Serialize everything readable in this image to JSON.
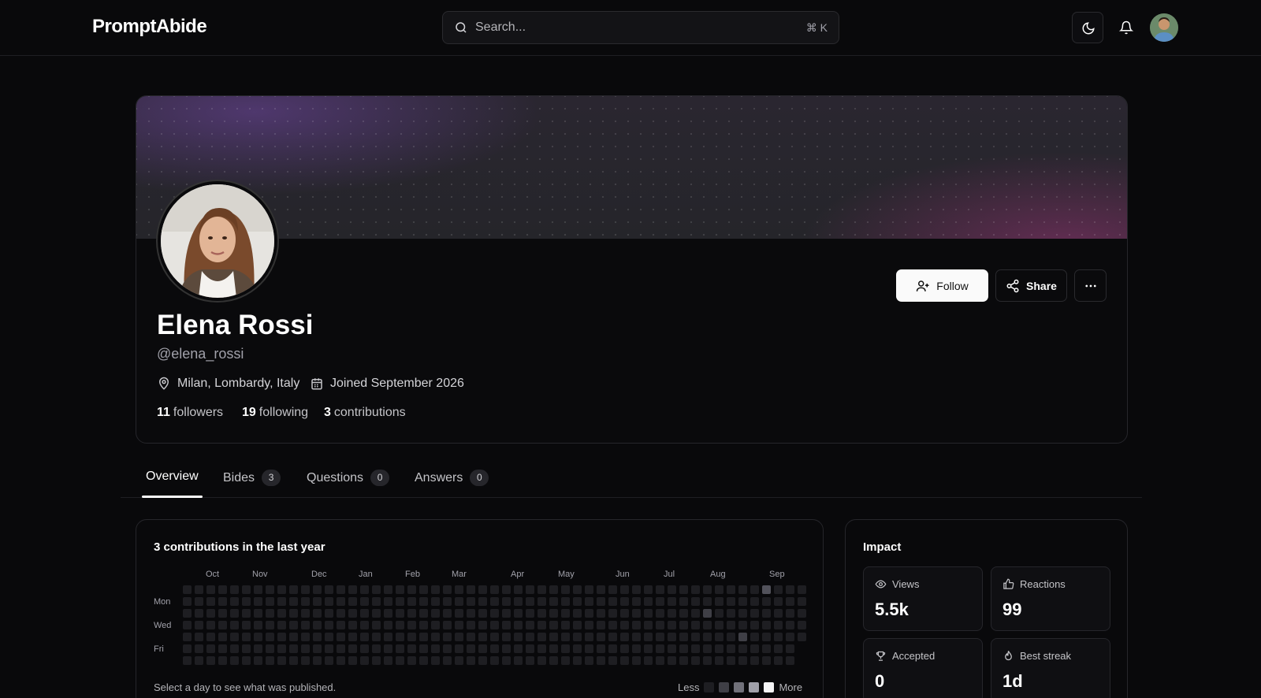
{
  "header": {
    "logo": "PromptAbide",
    "search_placeholder": "Search...",
    "shortcut": "⌘ K"
  },
  "profile": {
    "name": "Elena Rossi",
    "handle": "@elena_rossi",
    "location": "Milan, Lombardy, Italy",
    "joined": "Joined September 2026",
    "stats": [
      {
        "value": "11",
        "label": "followers"
      },
      {
        "value": "19",
        "label": "following"
      },
      {
        "value": "3",
        "label": "contributions"
      }
    ],
    "follow_label": "Follow",
    "share_label": "Share"
  },
  "tabs": [
    {
      "label": "Overview",
      "count": null,
      "active": true
    },
    {
      "label": "Bides",
      "count": "3"
    },
    {
      "label": "Questions",
      "count": "0"
    },
    {
      "label": "Answers",
      "count": "0"
    }
  ],
  "contributions": {
    "title": "3 contributions in the last year",
    "months": [
      "Oct",
      "Nov",
      "Dec",
      "Jan",
      "Feb",
      "Mar",
      "Apr",
      "May",
      "Jun",
      "Jul",
      "Aug",
      "Sep"
    ],
    "day_labels": [
      "Mon",
      "Wed",
      "Fri"
    ],
    "hint": "Select a day to see what was published.",
    "legend_less": "Less",
    "legend_more": "More",
    "colors": {
      "empty": "#1e1e22",
      "level1": "#3f3f46",
      "level2": "#52525b"
    }
  },
  "impact": {
    "title": "Impact",
    "tiles": [
      {
        "label": "Views",
        "value": "5.5k",
        "icon": "eye-icon"
      },
      {
        "label": "Reactions",
        "value": "99",
        "icon": "thumbs-up-icon"
      },
      {
        "label": "Accepted",
        "value": "0",
        "icon": "trophy-icon"
      },
      {
        "label": "Best streak",
        "value": "1d",
        "icon": "flame-icon"
      }
    ]
  }
}
